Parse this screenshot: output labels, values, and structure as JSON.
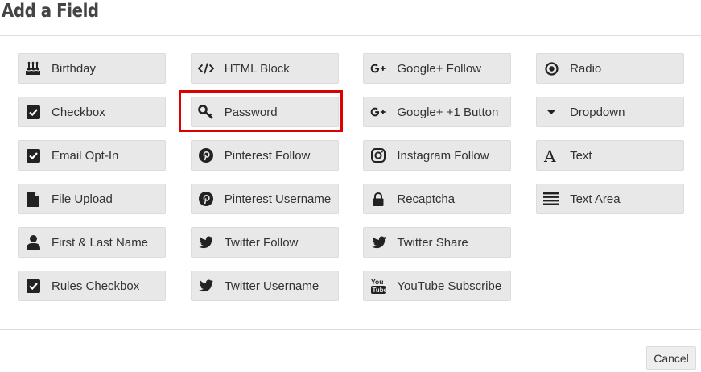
{
  "dialog": {
    "title": "Add a Field",
    "cancel_label": "Cancel"
  },
  "fields": [
    {
      "label": "Birthday",
      "icon": "cake-icon"
    },
    {
      "label": "Checkbox",
      "icon": "checkbox-icon"
    },
    {
      "label": "Email Opt-In",
      "icon": "checkbox-icon"
    },
    {
      "label": "File Upload",
      "icon": "file-icon"
    },
    {
      "label": "First & Last Name",
      "icon": "user-icon"
    },
    {
      "label": "Rules Checkbox",
      "icon": "checkbox-icon"
    },
    {
      "label": "HTML Block",
      "icon": "code-icon"
    },
    {
      "label": "Password",
      "icon": "key-icon",
      "selected": true
    },
    {
      "label": "Pinterest Follow",
      "icon": "pinterest-icon"
    },
    {
      "label": "Pinterest Username",
      "icon": "pinterest-icon"
    },
    {
      "label": "Twitter Follow",
      "icon": "twitter-icon"
    },
    {
      "label": "Twitter Username",
      "icon": "twitter-icon"
    },
    {
      "label": "Google+ Follow",
      "icon": "google-plus-icon"
    },
    {
      "label": "Google+ +1 Button",
      "icon": "google-plus-icon"
    },
    {
      "label": "Instagram Follow",
      "icon": "instagram-icon"
    },
    {
      "label": "Recaptcha",
      "icon": "lock-icon"
    },
    {
      "label": "Twitter Share",
      "icon": "twitter-icon"
    },
    {
      "label": "YouTube Subscribe",
      "icon": "youtube-icon"
    },
    {
      "label": "Radio",
      "icon": "radio-icon"
    },
    {
      "label": "Dropdown",
      "icon": "caret-down-icon"
    },
    {
      "label": "Text",
      "icon": "text-icon"
    },
    {
      "label": "Text Area",
      "icon": "text-area-icon"
    }
  ],
  "colors": {
    "selection_outline": "#dd0000",
    "button_bg": "#e8e8e8"
  }
}
